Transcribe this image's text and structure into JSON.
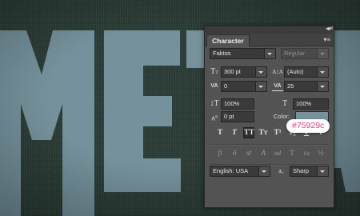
{
  "panel": {
    "tab_label": "Character",
    "font_family": "Faktos",
    "font_style": "Regular",
    "font_size": "300 pt",
    "leading": "(Auto)",
    "kerning": "0",
    "tracking": "25",
    "vertical_scale": "100%",
    "horizontal_scale": "100%",
    "baseline_shift": "0 pt",
    "color_label": "Color:",
    "color_value": "#75929c",
    "language": "English: USA",
    "antialias": "Sharp",
    "aa_glyph": "aₐ",
    "type_buttons": [
      "T",
      "T",
      "TT",
      "Tт",
      "T¹",
      "T₁",
      "T",
      "T"
    ],
    "opentype_buttons": [
      "fi",
      "ổ",
      "st",
      "A",
      "ad",
      "T",
      "1st",
      "½"
    ]
  },
  "canvas": {
    "letter_color": "#75929c"
  },
  "tooltip": {
    "text": "#75929c"
  }
}
